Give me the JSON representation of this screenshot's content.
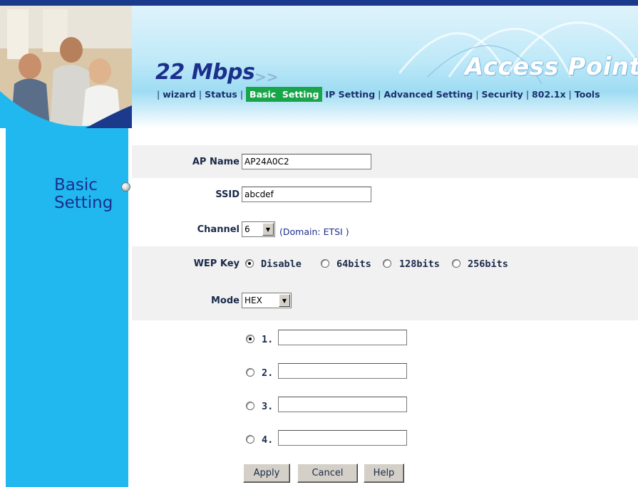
{
  "brand": {
    "speed": "22 Mbps",
    "arrows": ">>",
    "product": "Access Point"
  },
  "nav": {
    "items": [
      {
        "label": "wizard",
        "active": false
      },
      {
        "label": "Status",
        "active": false
      },
      {
        "label": "Basic  Setting",
        "active": true
      },
      {
        "label": "IP Setting",
        "active": false
      },
      {
        "label": "Advanced Setting",
        "active": false
      },
      {
        "label": "Security",
        "active": false
      },
      {
        "label": "802.1x",
        "active": false
      },
      {
        "label": "Tools",
        "active": false
      }
    ]
  },
  "sidebar": {
    "title_line1": "Basic",
    "title_line2": "Setting"
  },
  "form": {
    "ap_name": {
      "label": "AP Name",
      "value": "AP24A0C2"
    },
    "ssid": {
      "label": "SSID",
      "value": "abcdef"
    },
    "channel": {
      "label": "Channel",
      "value": "6",
      "domain_text": "(Domain: ETSI )"
    },
    "wep_key": {
      "label": "WEP Key",
      "options": [
        {
          "label": "Disable",
          "checked": true
        },
        {
          "label": "64bits",
          "checked": false
        },
        {
          "label": "128bits",
          "checked": false
        },
        {
          "label": "256bits",
          "checked": false
        }
      ]
    },
    "mode": {
      "label": "Mode",
      "value": "HEX"
    },
    "keys": [
      {
        "label": "1.",
        "checked": true,
        "value": ""
      },
      {
        "label": "2.",
        "checked": false,
        "value": ""
      },
      {
        "label": "3.",
        "checked": false,
        "value": ""
      },
      {
        "label": "4.",
        "checked": false,
        "value": ""
      }
    ]
  },
  "buttons": {
    "apply": "Apply",
    "cancel": "Cancel",
    "help": "Help"
  },
  "colors": {
    "nav_active": "#1aa54a",
    "sidebar": "#20b8ee",
    "top_strip": "#1b3a8c",
    "brand_text": "#1b2f8c"
  }
}
